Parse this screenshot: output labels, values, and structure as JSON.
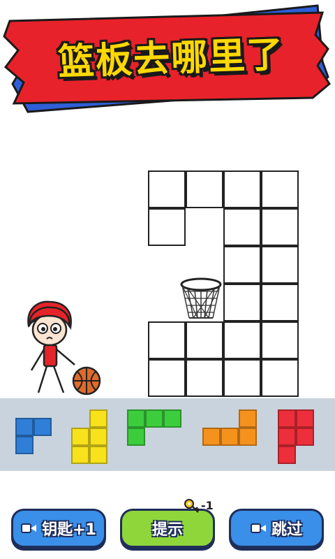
{
  "title": "篮板去哪里了",
  "buttons": {
    "key_label": "钥匙+1",
    "hint_label": "提示",
    "hint_cost": "-1",
    "skip_label": "跳过"
  },
  "colors": {
    "banner_red": "#e8222a",
    "banner_blue": "#2f5fd8",
    "title_yellow": "#ffd800",
    "tray_bg": "#c8d3dd",
    "btn_blue": "#3a8fe8",
    "btn_green": "#8fd63a",
    "piece_blue": "#2f7fd8",
    "piece_yellow": "#f7e21c",
    "piece_green": "#3ccd3c",
    "piece_orange": "#f5921e",
    "piece_red": "#ec2f3a"
  },
  "icons": [
    "video-icon",
    "key-icon",
    "basketball-hoop",
    "basketball",
    "stick-figure-player"
  ]
}
